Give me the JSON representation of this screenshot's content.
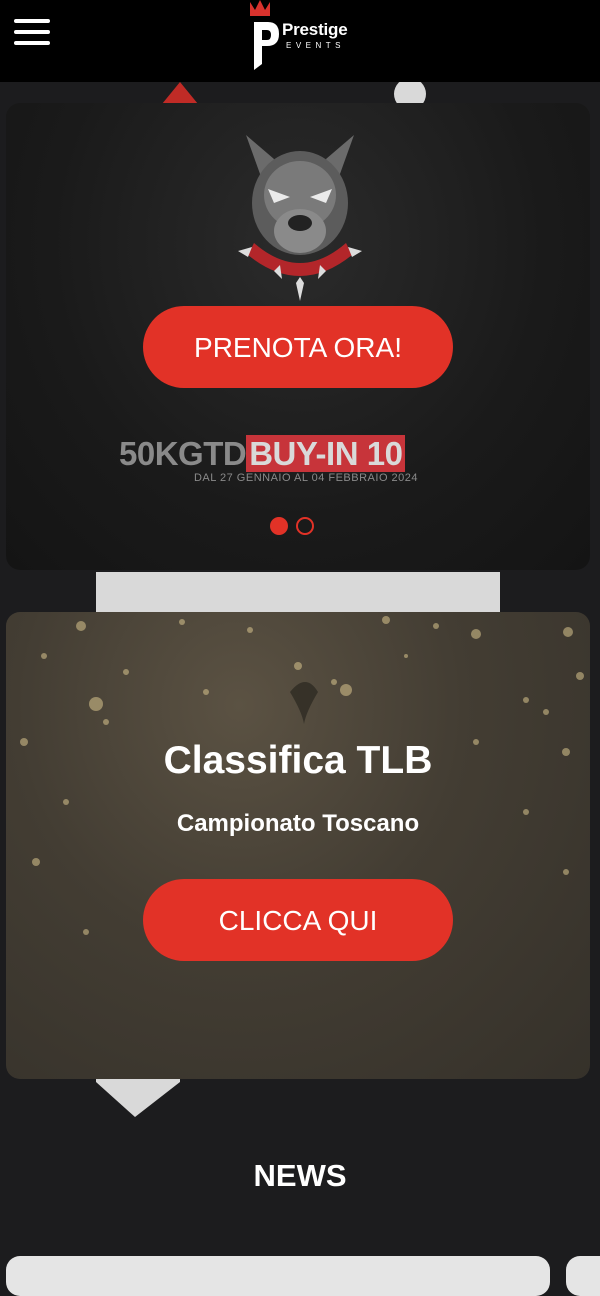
{
  "header": {
    "logo_name": "Prestige",
    "logo_sub": "EVENTS"
  },
  "hero": {
    "cta_label": "PRENOTA ORA!",
    "promo_left": "50KGTD",
    "promo_right": "BUY-IN 10",
    "promo_dates": "DAL 27 GENNAIO AL 04 FEBBRAIO 2024",
    "carousel": {
      "total": 2,
      "active": 1
    }
  },
  "ranking": {
    "title": "Classifica TLB",
    "subtitle": "Campionato Toscano",
    "cta_label": "CLICCA QUI"
  },
  "news": {
    "title": "NEWS"
  },
  "colors": {
    "accent": "#e23227",
    "header_bg": "#000000",
    "page_bg": "#1c1c1e"
  }
}
